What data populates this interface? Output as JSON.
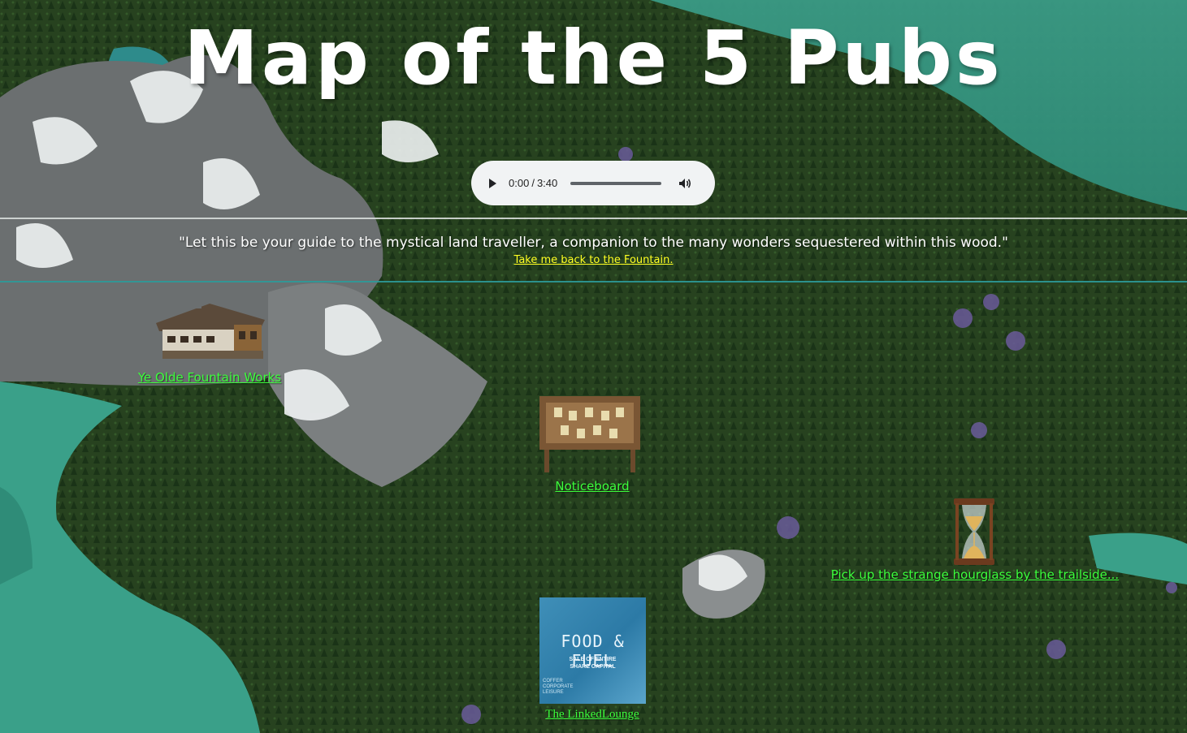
{
  "page": {
    "title": "Map of the 5 Pubs",
    "quote": "\"Let this be your guide to the mystical land traveller, a companion to the many wonders sequestered within this wood.\"",
    "back_link": "Take me back to the Fountain."
  },
  "audio": {
    "current_time": "0:00",
    "duration": "3:40",
    "progress": 0.0
  },
  "locations": [
    {
      "label": "Ye Olde Fountain Works",
      "icon": "house-icon"
    },
    {
      "label": "Noticeboard",
      "icon": "noticeboard-icon"
    },
    {
      "label": "Pick up the strange hourglass by the trailside...",
      "icon": "hourglass-icon"
    },
    {
      "label": "The LinkedLounge",
      "icon": "food-and-fuel-image"
    }
  ],
  "food_image": {
    "title": "FOOD & FUEL",
    "sub1": "SALE OF ENTIRE",
    "sub2": "SHARE CAPITAL",
    "foot": "COFFER CORPORATE LEISURE"
  },
  "colors": {
    "link_green": "#3cff3c",
    "link_yellow": "#ffff22",
    "water": "#3fa28a",
    "forest": "#24401f"
  }
}
